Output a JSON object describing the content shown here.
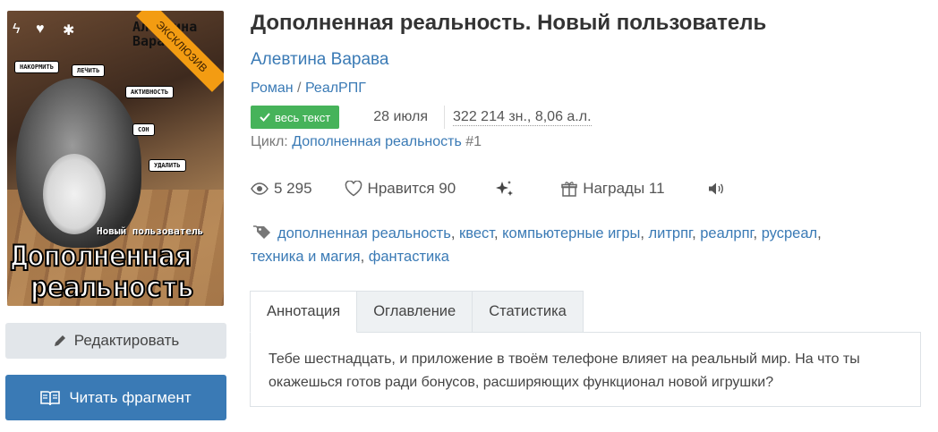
{
  "cover": {
    "ribbon": "ЭКСКЛЮЗИВ",
    "author_text": "Алевтина Варава",
    "subtitle_text": "Новый пользователь",
    "title_line1": "Дополненная",
    "title_line2": "реальность",
    "bubbles": [
      "НАКОРМИТЬ",
      "ЛЕЧИТЬ",
      "АКТИВНОСТЬ",
      "СОН",
      "УДАЛИТЬ"
    ]
  },
  "buttons": {
    "edit_label": "Редактировать",
    "edit_icon": "pencil-icon",
    "read_label": "Читать фрагмент",
    "read_icon": "book-icon"
  },
  "book": {
    "title": "Дополненная реальность. Новый пользователь",
    "author": "Алевтина Варава",
    "genres": [
      "Роман",
      "РеалРПГ"
    ],
    "genre_separator": " / ",
    "badge": "весь текст",
    "date": "28 июля",
    "size": "322 214 зн., 8,06 а.л.",
    "cycle_label": "Цикл:",
    "cycle_name": "Дополненная реальность",
    "cycle_number": "#1"
  },
  "stats": {
    "views": "5 295",
    "likes": "Нравится 90",
    "awards": "Награды 11"
  },
  "tags": [
    "дополненная реальность",
    "квест",
    "компьютерные игры",
    "литрпг",
    "реалрпг",
    "русреал",
    "техника и магия",
    "фантастика"
  ],
  "tabs": [
    "Аннотация",
    "Оглавление",
    "Статистика"
  ],
  "annotation": "Тебе шестнадцать, и приложение в твоём телефоне влияет на реальный мир. На что ты окажешься готов ради бонусов, расширяющих функционал новой игрушки?",
  "colors": {
    "link": "#3a7ab5",
    "badge": "#46b35a",
    "ribbon": "#f39c12",
    "read_button": "#3a7ab5"
  }
}
